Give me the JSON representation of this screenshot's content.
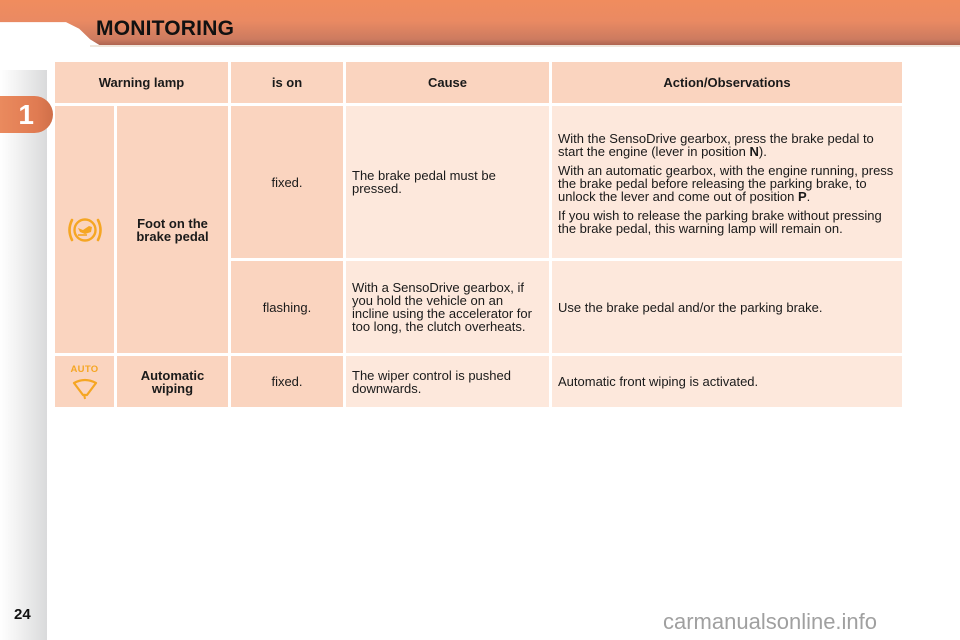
{
  "header": {
    "title": "MONITORING",
    "chapter_number": "1",
    "page_number": "24",
    "accent_color": "#ea8a5e"
  },
  "table": {
    "columns": [
      "Warning lamp",
      "is on",
      "Cause",
      "Action/Observations"
    ],
    "rows": [
      {
        "icon": "brake-pedal-warning-icon",
        "lamp_name": "Foot on the brake pedal",
        "states": [
          {
            "is_on": "fixed.",
            "cause": "The brake pedal must be pressed.",
            "action": {
              "p1_pre": "With the SensoDrive gearbox, press the brake pedal to start the engine (lever in position ",
              "p1_bold": "N",
              "p1_post": ").",
              "p2_pre": "With an automatic gearbox, with the engine running, press the brake pedal before releasing the parking brake, to unlock the lever and come out of position ",
              "p2_bold": "P",
              "p2_post": ".",
              "p3": "If you wish to release the parking brake without pressing the brake pedal, this warning lamp will remain on."
            }
          },
          {
            "is_on": "flashing.",
            "cause": "With a SensoDrive gearbox, if you hold the vehicle on an incline using the accelerator for too long, the clutch overheats.",
            "action": "Use the brake pedal and/or the parking brake."
          }
        ]
      },
      {
        "icon": "automatic-wiping-icon",
        "icon_label": "AUTO",
        "lamp_name": "Automatic wiping",
        "states": [
          {
            "is_on": "fixed.",
            "cause": "The wiper control is pushed downwards.",
            "action": "Automatic front wiping is activated."
          }
        ]
      }
    ],
    "icon_color": "#f5a623"
  },
  "watermark": "carmanualsonline.info"
}
